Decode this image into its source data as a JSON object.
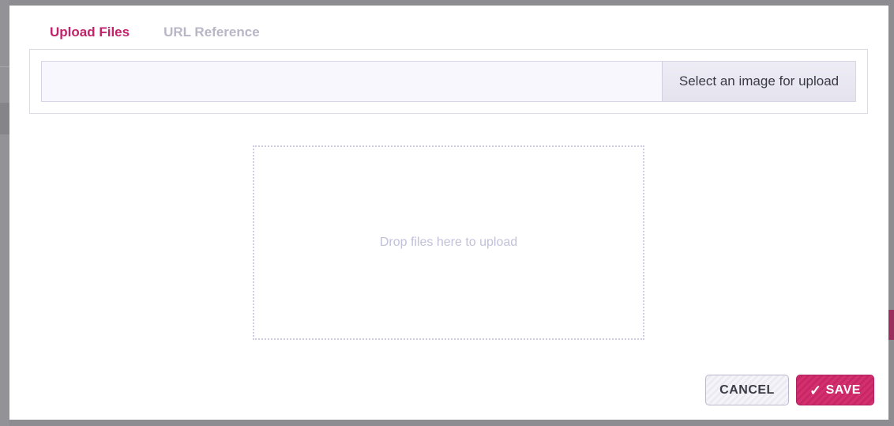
{
  "tabs": [
    {
      "label": "Upload Files",
      "active": true
    },
    {
      "label": "URL Reference",
      "active": false
    }
  ],
  "upload": {
    "file_value": "",
    "select_button_label": "Select an image for upload"
  },
  "dropzone": {
    "text": "Drop files here to upload"
  },
  "footer": {
    "cancel_label": "CANCEL",
    "save_label": "SAVE",
    "save_icon": "checkmark-icon",
    "save_icon_glyph": "✓"
  },
  "colors": {
    "accent": "#c2226a",
    "tab_inactive": "#b9b6c6",
    "save_button": "#d3306f"
  }
}
